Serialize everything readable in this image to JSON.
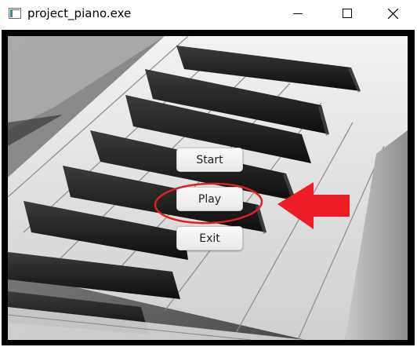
{
  "window": {
    "title": "project_piano.exe",
    "controls": [
      "minimize",
      "maximize",
      "close"
    ]
  },
  "menu": {
    "start_label": "Start",
    "play_label": "Play",
    "exit_label": "Exit"
  },
  "annotation": {
    "circle_color": "#e02020",
    "arrow_color": "#ee1c24"
  },
  "background": {
    "subject": "black and white piano keys photo"
  }
}
